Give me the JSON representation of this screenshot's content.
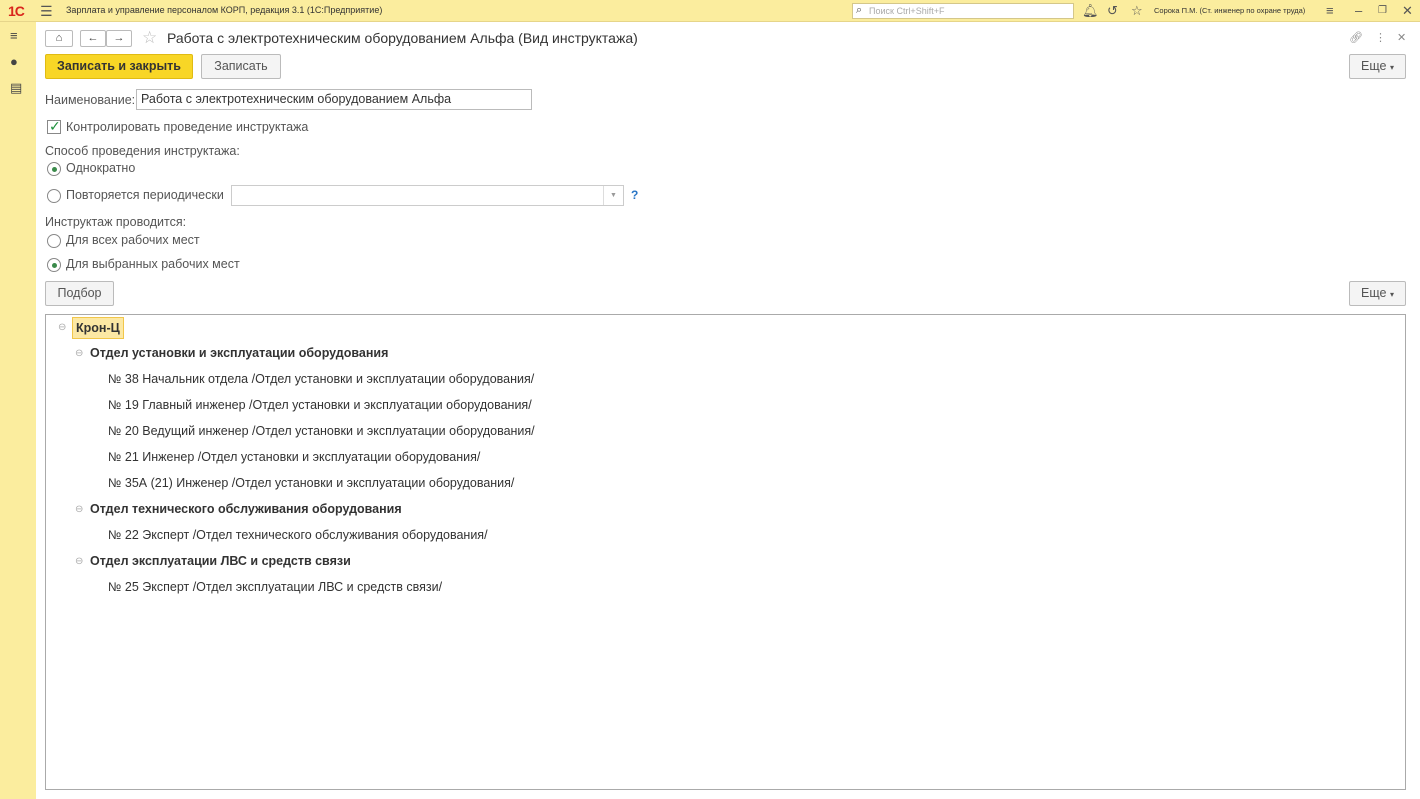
{
  "topbar": {
    "logo": "1С",
    "app_title": "Зарплата и управление персоналом КОРП, редакция 3.1  (1С:Предприятие)",
    "search_placeholder": "Поиск Ctrl+Shift+F",
    "user": "Сорока П.М. (Ст. инженер по охране труда)"
  },
  "form": {
    "title": "Работа с электротехническим оборудованием Альфа (Вид инструктажа)",
    "save_close_label": "Записать и закрыть",
    "save_label": "Записать",
    "more_label": "Еще",
    "name_label": "Наименование:",
    "name_value": "Работа с электротехническим оборудованием Альфа",
    "control_label": "Контролировать проведение инструктажа",
    "method_label": "Способ проведения инструктажа:",
    "once_label": "Однократно",
    "periodic_label": "Повторяется периодически",
    "periodic_value": "",
    "help_label": "?",
    "conducted_label": "Инструктаж проводится:",
    "all_label": "Для всех рабочих мест",
    "selected_label": "Для выбранных рабочих мест",
    "pick_label": "Подбор",
    "more2_label": "Еще"
  },
  "tree": {
    "root": "Крон-Ц",
    "groups": [
      {
        "name": "Отдел установки и эксплуатации оборудования",
        "items": [
          "№ 38 Начальник отдела /Отдел установки и эксплуатации оборудования/",
          "№ 19 Главный инженер /Отдел установки и эксплуатации оборудования/",
          "№ 20 Ведущий инженер /Отдел установки и эксплуатации оборудования/",
          "№ 21 Инженер /Отдел установки и эксплуатации оборудования/",
          "№ 35А (21) Инженер /Отдел установки и эксплуатации оборудования/"
        ]
      },
      {
        "name": "Отдел технического обслуживания оборудования",
        "items": [
          "№ 22 Эксперт /Отдел технического обслуживания оборудования/"
        ]
      },
      {
        "name": "Отдел эксплуатации ЛВС и средств связи",
        "items": [
          "№ 25 Эксперт /Отдел эксплуатации ЛВС и средств связи/"
        ]
      }
    ]
  }
}
